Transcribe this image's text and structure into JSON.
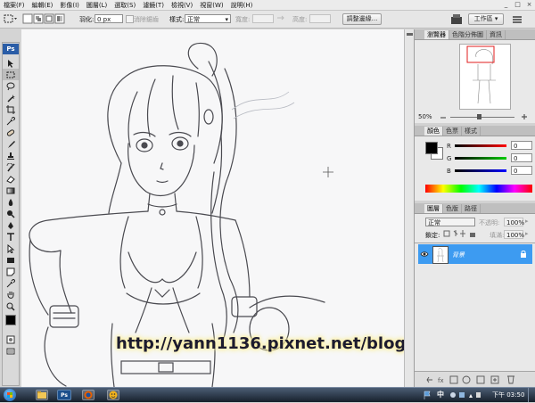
{
  "menu": [
    "檔案(F)",
    "編輯(E)",
    "影像(I)",
    "圖層(L)",
    "選取(S)",
    "濾鏡(T)",
    "檢視(V)",
    "視窗(W)",
    "說明(H)"
  ],
  "window_controls": [
    "_",
    "□",
    "×"
  ],
  "options": {
    "feather_label": "羽化:",
    "feather_value": "0 px",
    "antialias_label": "消除鋸齒",
    "style_label": "樣式:",
    "style_value": "正常",
    "width_label": "寬度:",
    "height_label": "高度:",
    "refine_button": "調整邊緣...",
    "workspace_button": "工作區 ▾"
  },
  "toolbox": {
    "logo": "Ps",
    "tools": [
      "move-tool-icon",
      "marquee-tool-icon",
      "lasso-tool-icon",
      "magic-wand-icon",
      "crop-tool-icon",
      "eyedropper-icon",
      "healing-brush-icon",
      "brush-tool-icon",
      "clone-stamp-icon",
      "history-brush-icon",
      "eraser-tool-icon",
      "gradient-tool-icon",
      "blur-tool-icon",
      "dodge-tool-icon",
      "pen-tool-icon",
      "type-tool-icon",
      "path-select-icon",
      "shape-tool-icon",
      "notes-tool-icon",
      "eyedropper2-icon",
      "hand-tool-icon",
      "zoom-tool-icon"
    ]
  },
  "canvas": {
    "watermark": "http://yann1136.pixnet.net/blog"
  },
  "navigator": {
    "tabs": [
      "瀏覽器",
      "色階分佈圖",
      "資訊"
    ],
    "zoom": "50%"
  },
  "color_panel": {
    "tabs": [
      "顏色",
      "色票",
      "樣式"
    ],
    "channels": [
      {
        "name": "R",
        "value": "0",
        "color": "#c00000"
      },
      {
        "name": "G",
        "value": "0",
        "color": "#00a000"
      },
      {
        "name": "B",
        "value": "0",
        "color": "#0000c0"
      }
    ]
  },
  "layers_panel": {
    "tabs": [
      "圖層",
      "色版",
      "路徑"
    ],
    "blend_mode": "正常",
    "opacity_label": "不透明:",
    "opacity_value": "100%",
    "lock_label": "鎖定:",
    "fill_label": "填滿:",
    "fill_value": "100%",
    "layer_name": "背景"
  },
  "taskbar": {
    "ps_label": "Ps",
    "ime": "中",
    "clock": "下午 03:50"
  },
  "colors": {
    "accent": "#3a9ef5",
    "layer_selected": "#3d9bf1"
  }
}
